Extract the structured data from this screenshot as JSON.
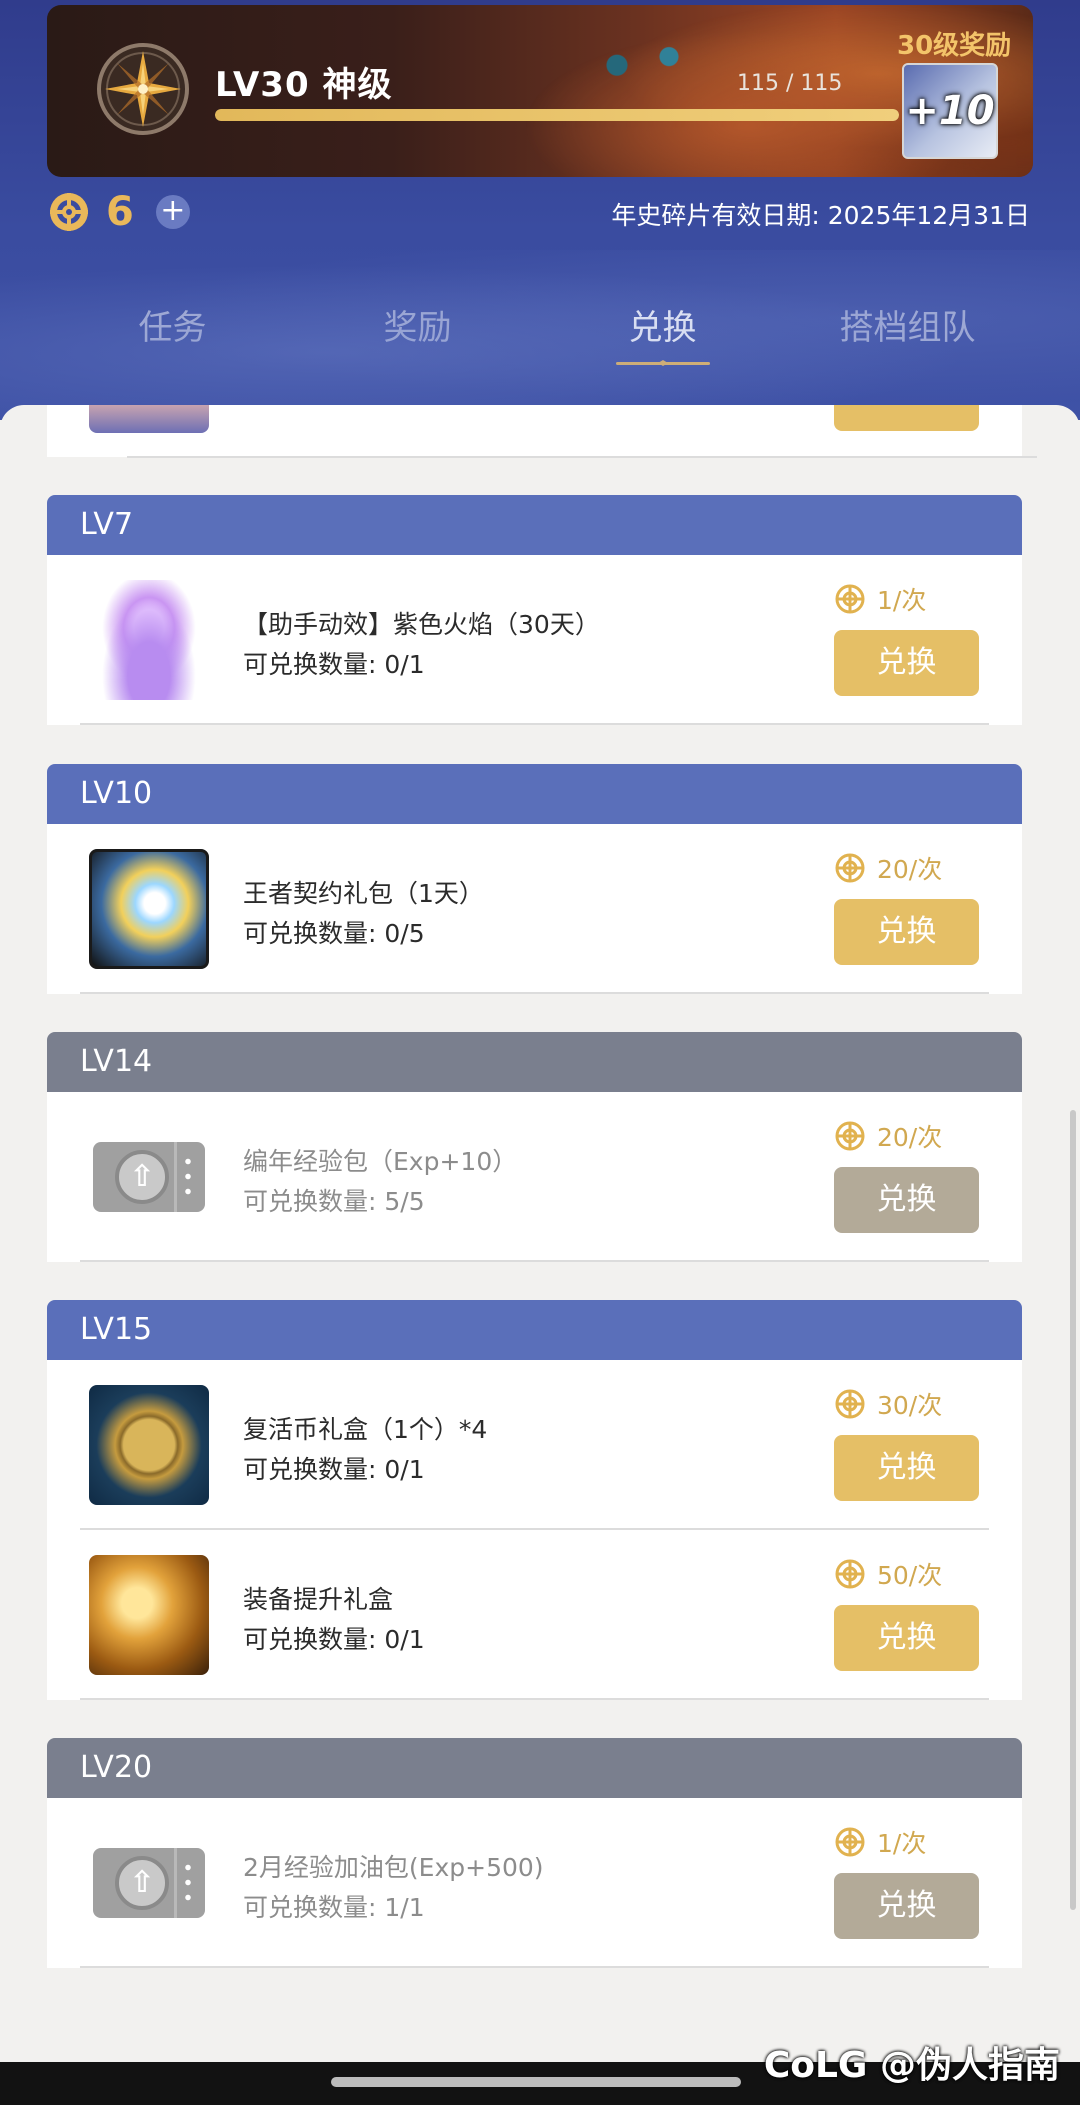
{
  "header": {
    "level_title": "LV30 神级",
    "exp_text": "115 / 115",
    "exp_progress": 1.0,
    "reward_label": "30级奖励",
    "reward_icon_text": "+10",
    "coin_count": "6",
    "plus_label": "+",
    "expiry_text": "年史碎片有效日期: 2025年12月31日"
  },
  "tabs": [
    {
      "label": "任务",
      "active": false
    },
    {
      "label": "奖励",
      "active": false
    },
    {
      "label": "兑换",
      "active": true
    },
    {
      "label": "搭档组队",
      "active": false
    }
  ],
  "colors": {
    "accent_gold": "#e5bf66",
    "header_blue": "#5a6fba",
    "header_gray": "#7a7f8e",
    "disabled_button": "#b3aa98"
  },
  "groups": [
    {
      "level": "LV7",
      "items": [
        {
          "name": "【助手动效】紫色火焰（30天）",
          "qty": "可兑换数量: 0/1",
          "cost": "1/次",
          "button": "兑换",
          "icon": "purple-flame-icon"
        }
      ]
    },
    {
      "level": "LV10",
      "items": [
        {
          "name": "王者契约礼包（1天）",
          "qty": "可兑换数量: 0/5",
          "cost": "20/次",
          "button": "兑换",
          "icon": "king-contract-icon"
        }
      ]
    },
    {
      "level": "LV14",
      "items": [
        {
          "name": "编年经验包（Exp+10）",
          "qty": "可兑换数量: 5/5",
          "cost": "20/次",
          "button": "兑换",
          "icon": "exp-ticket-icon"
        }
      ]
    },
    {
      "level": "LV15",
      "items": [
        {
          "name": "复活币礼盒（1个）*4",
          "qty": "可兑换数量: 0/1",
          "cost": "30/次",
          "button": "兑换",
          "icon": "revive-coin-icon"
        },
        {
          "name": "装备提升礼盒",
          "qty": "可兑换数量: 0/1",
          "cost": "50/次",
          "button": "兑换",
          "icon": "treasure-chest-icon"
        }
      ]
    },
    {
      "level": "LV20",
      "items": [
        {
          "name": "2月经验加油包(Exp+500)",
          "qty": "可兑换数量: 1/1",
          "cost": "1/次",
          "button": "兑换",
          "icon": "exp-ticket-icon"
        }
      ]
    }
  ],
  "watermark": "CoLG @伪人指南"
}
